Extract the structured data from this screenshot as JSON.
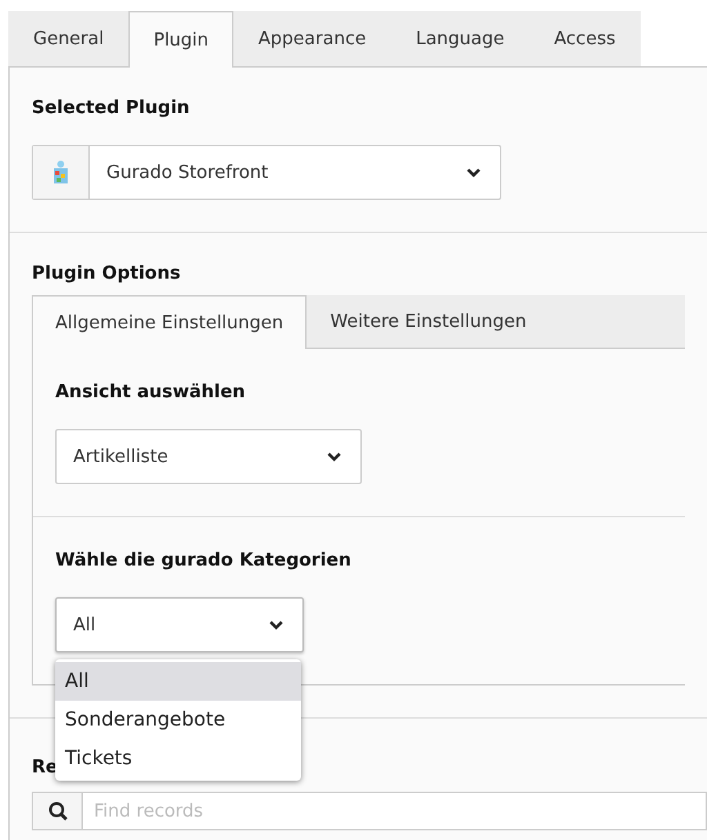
{
  "tabs": [
    {
      "label": "General",
      "selected": false
    },
    {
      "label": "Plugin",
      "selected": true
    },
    {
      "label": "Appearance",
      "selected": false
    },
    {
      "label": "Language",
      "selected": false
    },
    {
      "label": "Access",
      "selected": false
    }
  ],
  "selected_plugin": {
    "label": "Selected Plugin",
    "value": "Gurado Storefront"
  },
  "plugin_options": {
    "label": "Plugin Options",
    "tabs": [
      {
        "label": "Allgemeine Einstellungen",
        "selected": true
      },
      {
        "label": "Weitere Einstellungen",
        "selected": false
      }
    ],
    "view": {
      "label": "Ansicht auswählen",
      "value": "Artikelliste"
    },
    "categories": {
      "label": "Wähle die gurado Kategorien",
      "value": "All",
      "expanded": true,
      "options": [
        {
          "label": "All",
          "selected": true
        },
        {
          "label": "Sonderangebote",
          "selected": false
        },
        {
          "label": "Tickets",
          "selected": false
        }
      ]
    }
  },
  "records": {
    "label": "Re",
    "placeholder": "Find records"
  }
}
